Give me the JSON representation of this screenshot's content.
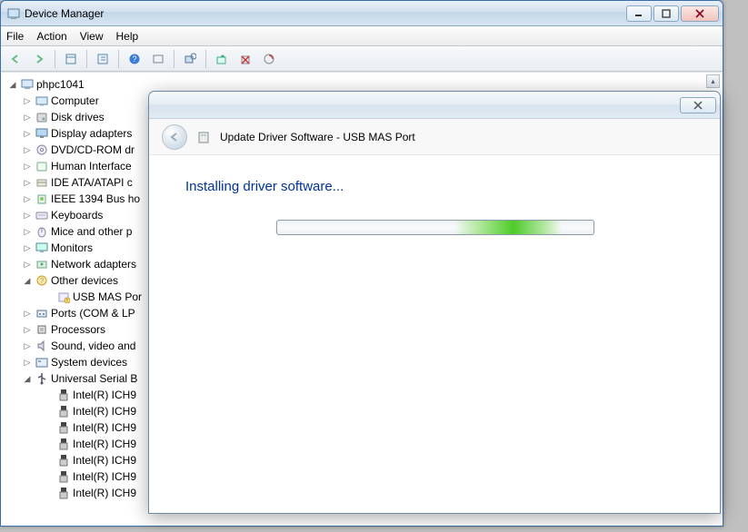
{
  "dm": {
    "title": "Device Manager",
    "menus": {
      "file": "File",
      "action": "Action",
      "view": "View",
      "help": "Help"
    },
    "root": "phpc1041",
    "nodes": [
      {
        "label": "Computer",
        "icon": "computer"
      },
      {
        "label": "Disk drives",
        "icon": "disk"
      },
      {
        "label": "Display adapters",
        "icon": "display"
      },
      {
        "label": "DVD/CD-ROM dr",
        "icon": "optical"
      },
      {
        "label": "Human Interface",
        "icon": "hid"
      },
      {
        "label": "IDE ATA/ATAPI c",
        "icon": "ide"
      },
      {
        "label": "IEEE 1394 Bus ho",
        "icon": "ieee"
      },
      {
        "label": "Keyboards",
        "icon": "keyboard"
      },
      {
        "label": "Mice and other p",
        "icon": "mouse"
      },
      {
        "label": "Monitors",
        "icon": "monitor"
      },
      {
        "label": "Network adapters",
        "icon": "network"
      }
    ],
    "other_devices": {
      "label": "Other devices",
      "child": "USB MAS Por"
    },
    "after_other": [
      {
        "label": "Ports (COM & LP",
        "icon": "port"
      },
      {
        "label": "Processors",
        "icon": "cpu"
      },
      {
        "label": "Sound, video and",
        "icon": "sound"
      },
      {
        "label": "System devices",
        "icon": "system"
      }
    ],
    "usb": {
      "label": "Universal Serial B",
      "children": [
        "Intel(R) ICH9",
        "Intel(R) ICH9",
        "Intel(R) ICH9",
        "Intel(R) ICH9",
        "Intel(R) ICH9",
        "Intel(R) ICH9",
        "Intel(R) ICH9"
      ]
    }
  },
  "upd": {
    "header": "Update Driver Software - USB MAS Port",
    "heading": "Installing driver software..."
  },
  "colors": {
    "heading_blue": "#003399"
  }
}
